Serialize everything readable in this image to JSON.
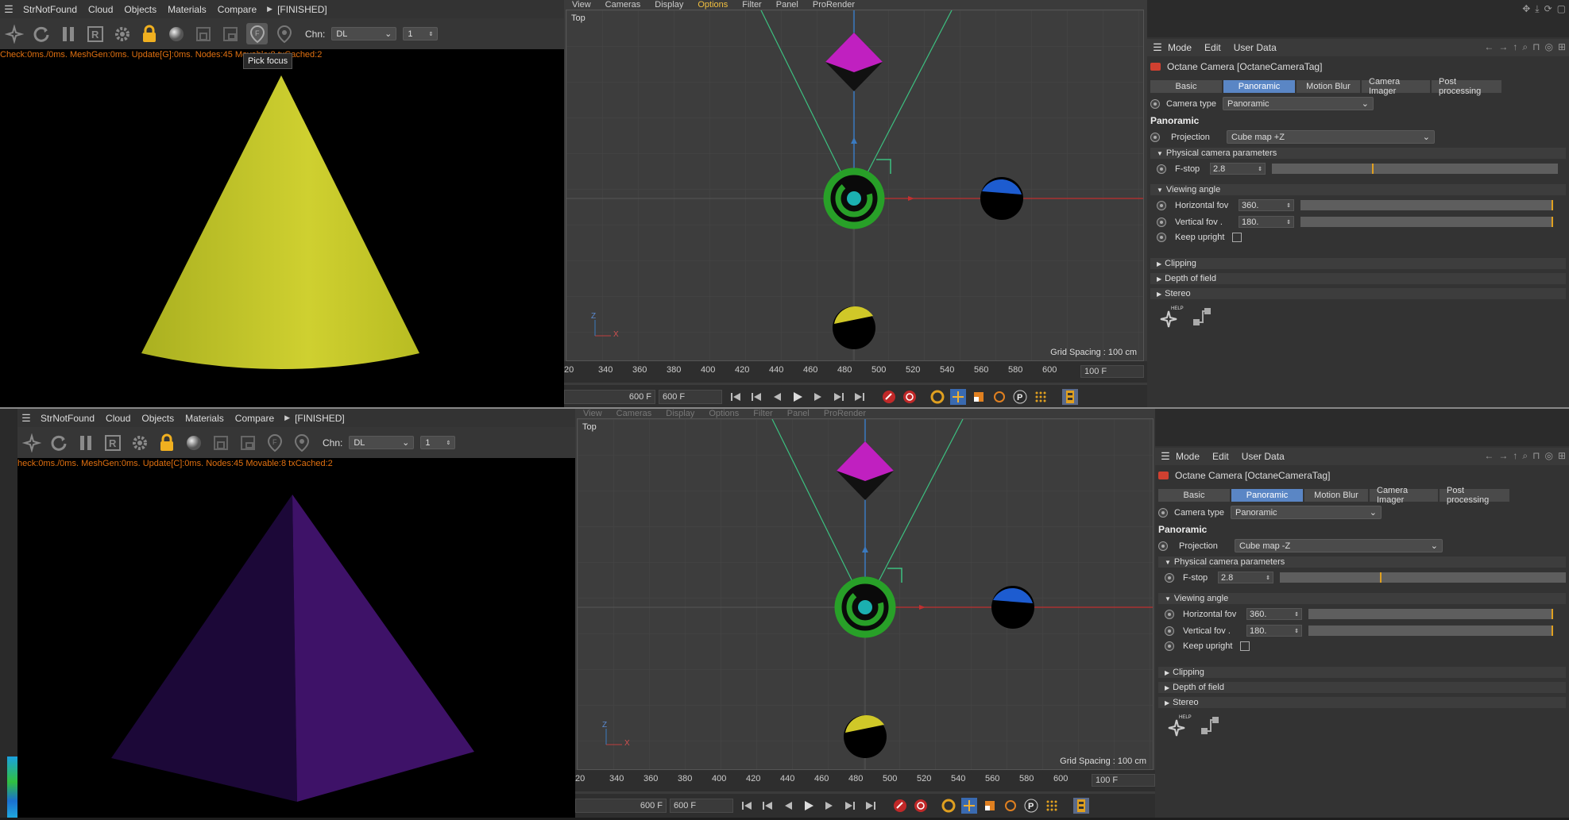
{
  "inst1": {
    "octane": {
      "menu": [
        "StrNotFound",
        "Cloud",
        "Objects",
        "Materials",
        "Compare"
      ],
      "status_finished": "[FINISHED]",
      "chn_label": "Chn:",
      "chn_value": "DL",
      "chn_num": "1",
      "stats": "Check:0ms./0ms. MeshGen:0ms. Update[G]:0ms. Nodes:45 Movable:8 txCached:2",
      "tooltip": "Pick focus"
    },
    "viewport": {
      "menu": [
        "View",
        "Cameras",
        "Display",
        "Options",
        "Filter",
        "Panel",
        "ProRender"
      ],
      "active_menu": "Options",
      "label": "Top",
      "grid_spacing": "Grid Spacing : 100 cm",
      "ticks": [
        "20",
        "340",
        "360",
        "380",
        "400",
        "420",
        "440",
        "460",
        "480",
        "500",
        "520",
        "540",
        "560",
        "580",
        "600"
      ],
      "end_frame": "100 F",
      "frame_a": "600 F",
      "frame_b": "600 F"
    },
    "attr": {
      "menu": [
        "Mode",
        "Edit",
        "User Data"
      ],
      "tag_title": "Octane Camera [OctaneCameraTag]",
      "tabs": [
        "Basic",
        "Panoramic",
        "Motion Blur",
        "Camera Imager",
        "Post processing"
      ],
      "active_tab": "Panoramic",
      "camera_type_label": "Camera type",
      "camera_type_value": "Panoramic",
      "section_title": "Panoramic",
      "projection_label": "Projection",
      "projection_value": "Cube map +Z",
      "group_physical": "Physical camera parameters",
      "fstop_label": "F-stop",
      "fstop_value": "2.8",
      "fstop_fraction": 0.35,
      "group_viewing": "Viewing angle",
      "hfov_label": "Horizontal fov",
      "hfov_value": "360.",
      "vfov_label": "Vertical fov .",
      "vfov_value": "180.",
      "keep_upright_label": "Keep upright",
      "group_clipping": "Clipping",
      "group_dof": "Depth of field",
      "group_stereo": "Stereo",
      "help_label": "HELP"
    }
  },
  "inst2": {
    "octane": {
      "menu": [
        "StrNotFound",
        "Cloud",
        "Objects",
        "Materials",
        "Compare"
      ],
      "status_finished": "[FINISHED]",
      "chn_label": "Chn:",
      "chn_value": "DL",
      "chn_num": "1",
      "stats": "heck:0ms./0ms. MeshGen:0ms. Update[C]:0ms. Nodes:45 Movable:8 txCached:2"
    },
    "viewport": {
      "menu": [
        "View",
        "Cameras",
        "Display",
        "Options",
        "Filter",
        "Panel",
        "ProRender"
      ],
      "label": "Top",
      "grid_spacing": "Grid Spacing : 100 cm",
      "ticks": [
        "20",
        "340",
        "360",
        "380",
        "400",
        "420",
        "440",
        "460",
        "480",
        "500",
        "520",
        "540",
        "560",
        "580",
        "600"
      ],
      "end_frame": "100 F",
      "frame_a": "600 F",
      "frame_b": "600 F"
    },
    "attr": {
      "menu": [
        "Mode",
        "Edit",
        "User Data"
      ],
      "tag_title": "Octane Camera [OctaneCameraTag]",
      "tabs": [
        "Basic",
        "Panoramic",
        "Motion Blur",
        "Camera Imager",
        "Post processing"
      ],
      "active_tab": "Panoramic",
      "camera_type_label": "Camera type",
      "camera_type_value": "Panoramic",
      "section_title": "Panoramic",
      "projection_label": "Projection",
      "projection_value": "Cube map -Z",
      "group_physical": "Physical camera parameters",
      "fstop_label": "F-stop",
      "fstop_value": "2.8",
      "fstop_fraction": 0.35,
      "group_viewing": "Viewing angle",
      "hfov_label": "Horizontal fov",
      "hfov_value": "360.",
      "vfov_label": "Vertical fov .",
      "vfov_value": "180.",
      "keep_upright_label": "Keep upright",
      "group_clipping": "Clipping",
      "group_dof": "Depth of field",
      "group_stereo": "Stereo",
      "help_label": "HELP"
    }
  },
  "colors": {
    "render_cone": "#c8c820",
    "render_pyramid": "#3a1060",
    "accent_tab": "#5a86c5",
    "status_orange": "#e07010",
    "marker_orange": "#e0a020"
  }
}
